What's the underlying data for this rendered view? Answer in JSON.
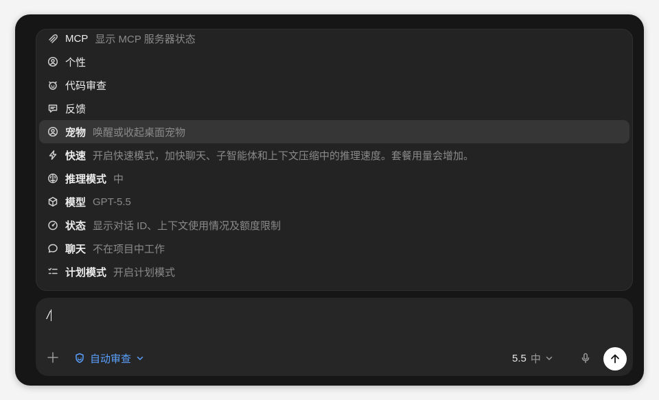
{
  "menu": {
    "items": [
      {
        "icon": "mcp-icon",
        "label": "MCP",
        "desc": "显示 MCP 服务器状态",
        "bold": false,
        "selected": false
      },
      {
        "icon": "personality-icon",
        "label": "个性",
        "desc": "",
        "bold": false,
        "selected": false
      },
      {
        "icon": "code-review-icon",
        "label": "代码审查",
        "desc": "",
        "bold": false,
        "selected": false
      },
      {
        "icon": "feedback-icon",
        "label": "反馈",
        "desc": "",
        "bold": false,
        "selected": false
      },
      {
        "icon": "pet-icon",
        "label": "宠物",
        "desc": "唤醒或收起桌面宠物",
        "bold": true,
        "selected": true
      },
      {
        "icon": "lightning-icon",
        "label": "快速",
        "desc": "开启快速模式，加快聊天、子智能体和上下文压缩中的推理速度。套餐用量会增加。",
        "bold": true,
        "selected": false
      },
      {
        "icon": "brain-icon",
        "label": "推理模式",
        "desc": "中",
        "bold": true,
        "selected": false
      },
      {
        "icon": "cube-icon",
        "label": "模型",
        "desc": "GPT-5.5",
        "bold": true,
        "selected": false
      },
      {
        "icon": "gauge-icon",
        "label": "状态",
        "desc": "显示对话 ID、上下文使用情况及额度限制",
        "bold": true,
        "selected": false
      },
      {
        "icon": "chat-bubble-icon",
        "label": "聊天",
        "desc": "不在项目中工作",
        "bold": true,
        "selected": false
      },
      {
        "icon": "checklist-icon",
        "label": "计划模式",
        "desc": "开启计划模式",
        "bold": true,
        "selected": false
      }
    ]
  },
  "composer": {
    "input_value": "/",
    "review_label": "自动审查",
    "model_version": "5.5",
    "model_level": "中"
  },
  "colors": {
    "accent": "#5aa0ff",
    "window_bg": "#161616",
    "menu_bg": "#232323",
    "selected_bg": "#363636"
  }
}
